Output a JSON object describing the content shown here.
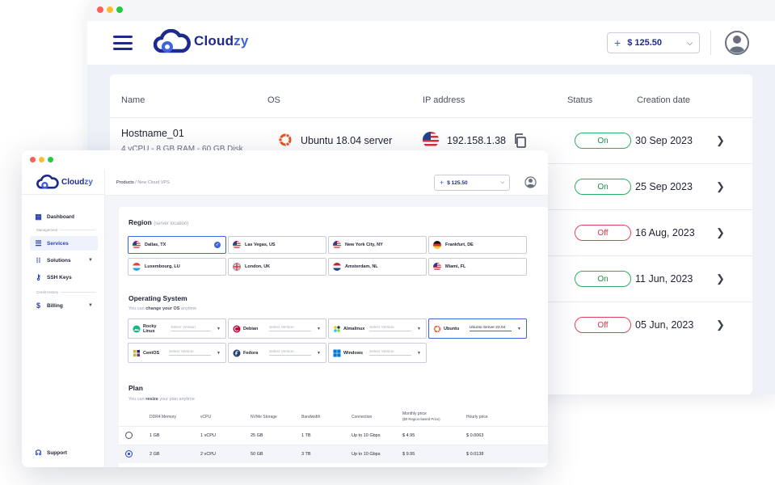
{
  "back": {
    "brand": {
      "prefix": "Cloud",
      "suffix": "zy"
    },
    "balance": "$ 125.50",
    "columns": [
      "Name",
      "OS",
      "IP address",
      "Status",
      "Creation date"
    ],
    "rows": [
      {
        "name": "Hostname_01",
        "specs": "4 vCPU - 8 GB RAM - 60 GB Disk",
        "os": "Ubuntu 18.04 server",
        "ip": "192.158.1.38",
        "status": "On",
        "date": "30 Sep 2023"
      },
      {
        "status": "On",
        "date": "25 Sep 2023"
      },
      {
        "status": "Off",
        "date": "16 Aug, 2023"
      },
      {
        "status": "On",
        "date": "11 Jun, 2023"
      },
      {
        "status": "Off",
        "date": "05 Jun, 2023"
      }
    ]
  },
  "front": {
    "brand": {
      "prefix": "Cloud",
      "suffix": "zy"
    },
    "breadcrumb": {
      "root": "Products",
      "sep": "/",
      "current": "New Cloud VPS"
    },
    "balance": "$ 125.50",
    "sidebar": {
      "dashboard": "Dashboard",
      "management_label": "Management",
      "services": "Services",
      "solutions": "Solutions",
      "ssh_keys": "SSH Keys",
      "credit_label": "Credit History",
      "billing": "Billing",
      "support": "Support"
    },
    "region": {
      "title": "Region",
      "hint": "(server location)",
      "items": [
        "Dallas, TX",
        "Las Vegas, US",
        "New York City, NY",
        "Frankfurt, DE",
        "Luxembourg, LU",
        "London, UK",
        "Amsterdam, NL",
        "Miami, FL"
      ]
    },
    "os": {
      "title": "Operating System",
      "sub_prefix": "You can ",
      "sub_bold": "change your OS",
      "sub_suffix": " anytime",
      "items": [
        {
          "name": "Rocky Linux",
          "version": "Select Version"
        },
        {
          "name": "Debian",
          "version": "Select Version"
        },
        {
          "name": "Almalinux",
          "version": "Select Version"
        },
        {
          "name": "Ubuntu",
          "version": "Ubuntu Server 22.04"
        },
        {
          "name": "CentOS",
          "version": "Select Version"
        },
        {
          "name": "Fedora",
          "version": "Select Version"
        },
        {
          "name": "Windows",
          "version": "Select Version"
        }
      ]
    },
    "plan": {
      "title": "Plan",
      "sub_prefix": "You can ",
      "sub_bold": "resize",
      "sub_suffix": " your plan anytime",
      "headers": [
        "DDR4 Memory",
        "vCPU",
        "NVMe Storage",
        "Bandwidth",
        "Connection",
        "Monthly price",
        "($0 Region-based Price)",
        "Hourly price"
      ],
      "rows": [
        {
          "memory": "1 GB",
          "vcpu": "1 vCPU",
          "storage": "25 GB",
          "bandwidth": "1 TB",
          "connection": "Up to 10 Gbps",
          "monthly": "$ 4.95",
          "hourly": "$ 0.0063"
        },
        {
          "memory": "2 GB",
          "vcpu": "2 vCPU",
          "storage": "50 GB",
          "bandwidth": "3 TB",
          "connection": "Up to 10 Gbps",
          "monthly": "$ 9.95",
          "hourly": "$ 0.0138"
        }
      ]
    }
  }
}
